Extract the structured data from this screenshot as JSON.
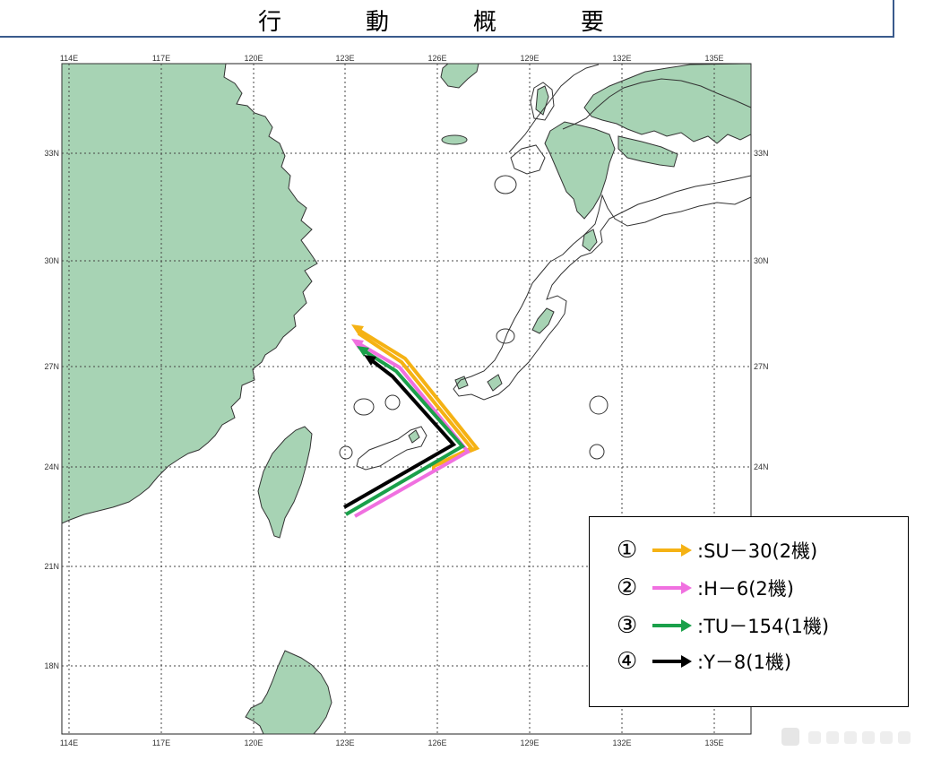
{
  "title": "行　動　概　要",
  "map": {
    "lon_ticks": [
      "114E",
      "117E",
      "120E",
      "123E",
      "126E",
      "129E",
      "132E",
      "135E"
    ],
    "lat_ticks": [
      "33N",
      "30N",
      "27N",
      "24N",
      "21N",
      "18N"
    ],
    "colors": {
      "land": "#a7d3b4",
      "coast": "#333333",
      "grid": "#444444",
      "depth_contour": "#333333"
    }
  },
  "legend": {
    "items": [
      {
        "num": "①",
        "label": ":SU－30(2機)",
        "color": "#f5b214",
        "icon": "orange-arrow-icon"
      },
      {
        "num": "②",
        "label": ":H－6(2機)",
        "color": "#f070e0",
        "icon": "pink-arrow-icon"
      },
      {
        "num": "③",
        "label": ":TU－154(1機)",
        "color": "#1aa04a",
        "icon": "green-arrow-icon"
      },
      {
        "num": "④",
        "label": ":Y－8(1機)",
        "color": "#000000",
        "icon": "black-arrow-icon"
      }
    ]
  },
  "flight_paths": [
    {
      "aircraft": "SU－30",
      "color": "#f5b214"
    },
    {
      "aircraft": "H－6",
      "color": "#f070e0"
    },
    {
      "aircraft": "TU－154",
      "color": "#1aa04a"
    },
    {
      "aircraft": "Y－8",
      "color": "#000000"
    }
  ]
}
